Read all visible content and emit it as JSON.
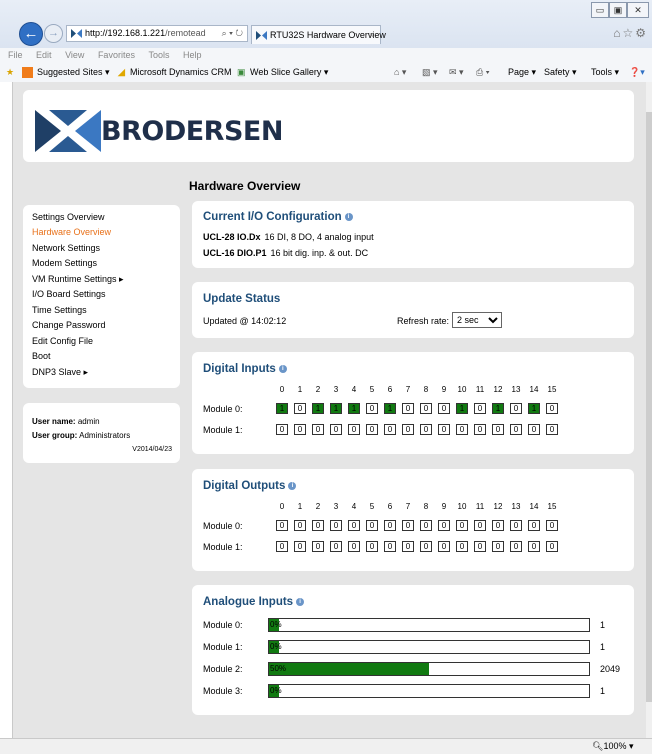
{
  "browser": {
    "url_host": "http://192.168.1.221",
    "url_path": "/remotead",
    "tab_title": "RTU32S Hardware Overview",
    "menu": [
      "File",
      "Edit",
      "View",
      "Favorites",
      "Tools",
      "Help"
    ],
    "favorites": [
      "Suggested Sites ▾",
      "Microsoft Dynamics CRM",
      "Web Slice Gallery ▾"
    ],
    "toolbar": [
      "Page ▾",
      "Safety ▾",
      "Tools ▾"
    ],
    "zoom": "100%"
  },
  "brand": {
    "name": "BRODERSEN"
  },
  "page": {
    "heading": "Hardware Overview"
  },
  "nav": {
    "items": [
      {
        "label": "Settings Overview",
        "active": false
      },
      {
        "label": "Hardware Overview",
        "active": true
      },
      {
        "label": "Network Settings",
        "active": false
      },
      {
        "label": "Modem Settings",
        "active": false
      },
      {
        "label": "VM Runtime Settings ▸",
        "active": false
      },
      {
        "label": "I/O Board Settings",
        "active": false
      },
      {
        "label": "Time Settings",
        "active": false
      },
      {
        "label": "Change Password",
        "active": false
      },
      {
        "label": "Edit Config File",
        "active": false
      },
      {
        "label": "Boot",
        "active": false
      },
      {
        "label": "DNP3 Slave ▸",
        "active": false
      }
    ]
  },
  "user": {
    "name_label": "User name:",
    "name": "admin",
    "group_label": "User group:",
    "group": "Administrators",
    "version": "V2014/04/23"
  },
  "io_config": {
    "title": "Current I/O Configuration",
    "lines": [
      {
        "model": "UCL-28 IO.Dx",
        "desc": "16 DI, 8 DO, 4 analog input"
      },
      {
        "model": "UCL-16 DIO.P1",
        "desc": "16 bit dig. inp. & out. DC"
      }
    ]
  },
  "update_status": {
    "title": "Update Status",
    "updated": "Updated @ 14:02:12",
    "refresh_label": "Refresh rate:",
    "refresh_value": "2 sec"
  },
  "digital_inputs": {
    "title": "Digital Inputs",
    "bit_headers": [
      "0",
      "1",
      "2",
      "3",
      "4",
      "5",
      "6",
      "7",
      "8",
      "9",
      "10",
      "11",
      "12",
      "13",
      "14",
      "15"
    ],
    "modules": [
      {
        "label": "Module 0:",
        "bits": [
          1,
          0,
          1,
          1,
          1,
          0,
          1,
          0,
          0,
          0,
          1,
          0,
          1,
          0,
          1,
          0
        ]
      },
      {
        "label": "Module 1:",
        "bits": [
          0,
          0,
          0,
          0,
          0,
          0,
          0,
          0,
          0,
          0,
          0,
          0,
          0,
          0,
          0,
          0
        ]
      }
    ]
  },
  "digital_outputs": {
    "title": "Digital Outputs",
    "bit_headers": [
      "0",
      "1",
      "2",
      "3",
      "4",
      "5",
      "6",
      "7",
      "8",
      "9",
      "10",
      "11",
      "12",
      "13",
      "14",
      "15"
    ],
    "modules": [
      {
        "label": "Module 0:",
        "bits": [
          0,
          0,
          0,
          0,
          0,
          0,
          0,
          0,
          0,
          0,
          0,
          0,
          0,
          0,
          0,
          0
        ]
      },
      {
        "label": "Module 1:",
        "bits": [
          0,
          0,
          0,
          0,
          0,
          0,
          0,
          0,
          0,
          0,
          0,
          0,
          0,
          0,
          0,
          0
        ]
      }
    ]
  },
  "analogue_inputs": {
    "title": "Analogue Inputs",
    "modules": [
      {
        "label": "Module 0:",
        "percent_label": "0%",
        "fraction": 0.0,
        "value": "1"
      },
      {
        "label": "Module 1:",
        "percent_label": "0%",
        "fraction": 0.0,
        "value": "1"
      },
      {
        "label": "Module 2:",
        "percent_label": "50%",
        "fraction": 0.5,
        "value": "2049"
      },
      {
        "label": "Module 3:",
        "percent_label": "0%",
        "fraction": 0.0,
        "value": "1"
      }
    ]
  },
  "colors": {
    "accent_active_nav": "#e8711a",
    "section_title": "#1f4e79",
    "bit_on": "#117a11"
  }
}
